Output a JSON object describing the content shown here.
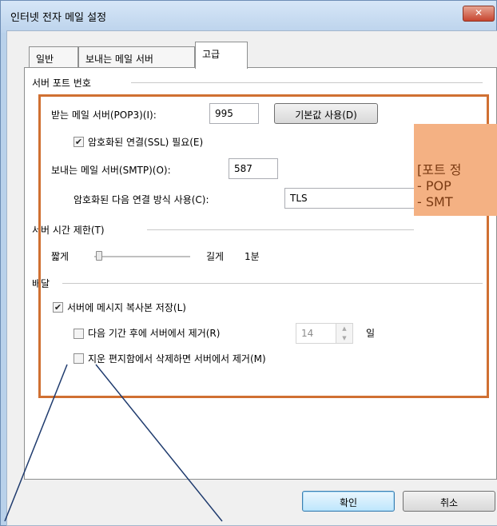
{
  "window": {
    "title": "인터넷 전자 메일 설정",
    "close_label": "✕"
  },
  "tabs": [
    {
      "label": "일반"
    },
    {
      "label": "보내는 메일 서버"
    },
    {
      "label": "고급"
    }
  ],
  "server_ports": {
    "section_title": "서버 포트 번호",
    "incoming_label": "받는 메일 서버(POP3)(I):",
    "incoming_value": "995",
    "default_button": "기본값 사용(D)",
    "ssl_checkbox": "암호화된 연결(SSL) 필요(E)",
    "ssl_checked": true,
    "outgoing_label": "보내는 메일 서버(SMTP)(O):",
    "outgoing_value": "587",
    "encryption_label": "암호화된 다음 연결 방식 사용(C):",
    "encryption_value": "TLS"
  },
  "timeout": {
    "section_title": "서버 시간 제한(T)",
    "short_label": "짧게",
    "long_label": "길게",
    "value": "1분",
    "slider_level": 0.05
  },
  "delivery": {
    "section_title": "배달",
    "keep_copy_label": "서버에 메시지 복사본 저장(L)",
    "keep_copy_checked": true,
    "remove_after_label": "다음 기간 후에 서버에서 제거(R)",
    "remove_after_checked": false,
    "days_value": "14",
    "days_unit": "일",
    "remove_deleted_label": "지운 편지함에서 삭제하면 서버에서 제거(M)",
    "remove_deleted_checked": false
  },
  "buttons": {
    "ok": "확인",
    "cancel": "취소"
  },
  "callout": {
    "line1": "[포트 정",
    "line2": "-  POP",
    "line3": "-  SMT"
  },
  "colors": {
    "highlight_border": "#d07032",
    "callout_fill": "#f4b183",
    "arrow": "#1f3b6e"
  }
}
